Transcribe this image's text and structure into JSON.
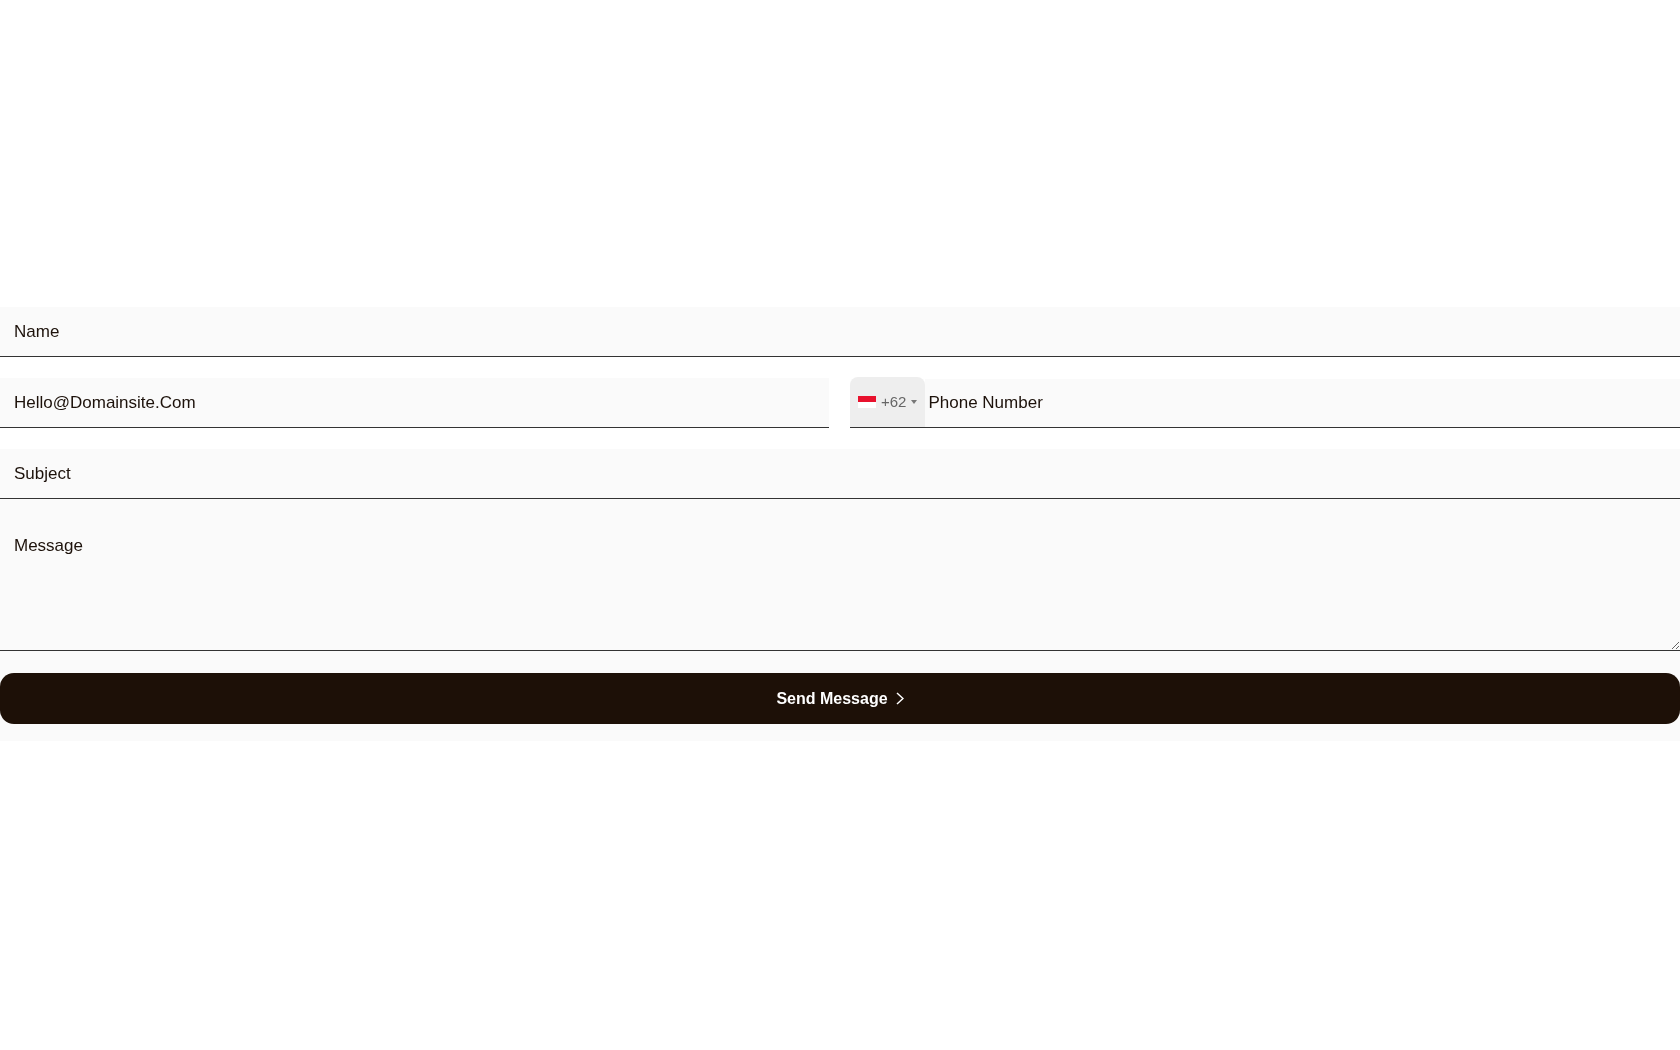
{
  "form": {
    "name": {
      "placeholder": "Name"
    },
    "email": {
      "placeholder": "Hello@Domainsite.Com"
    },
    "phone": {
      "country_code": "+62",
      "placeholder": "Phone Number"
    },
    "subject": {
      "placeholder": "Subject"
    },
    "message": {
      "placeholder": "Message"
    },
    "submit": {
      "label": "Send Message"
    }
  }
}
